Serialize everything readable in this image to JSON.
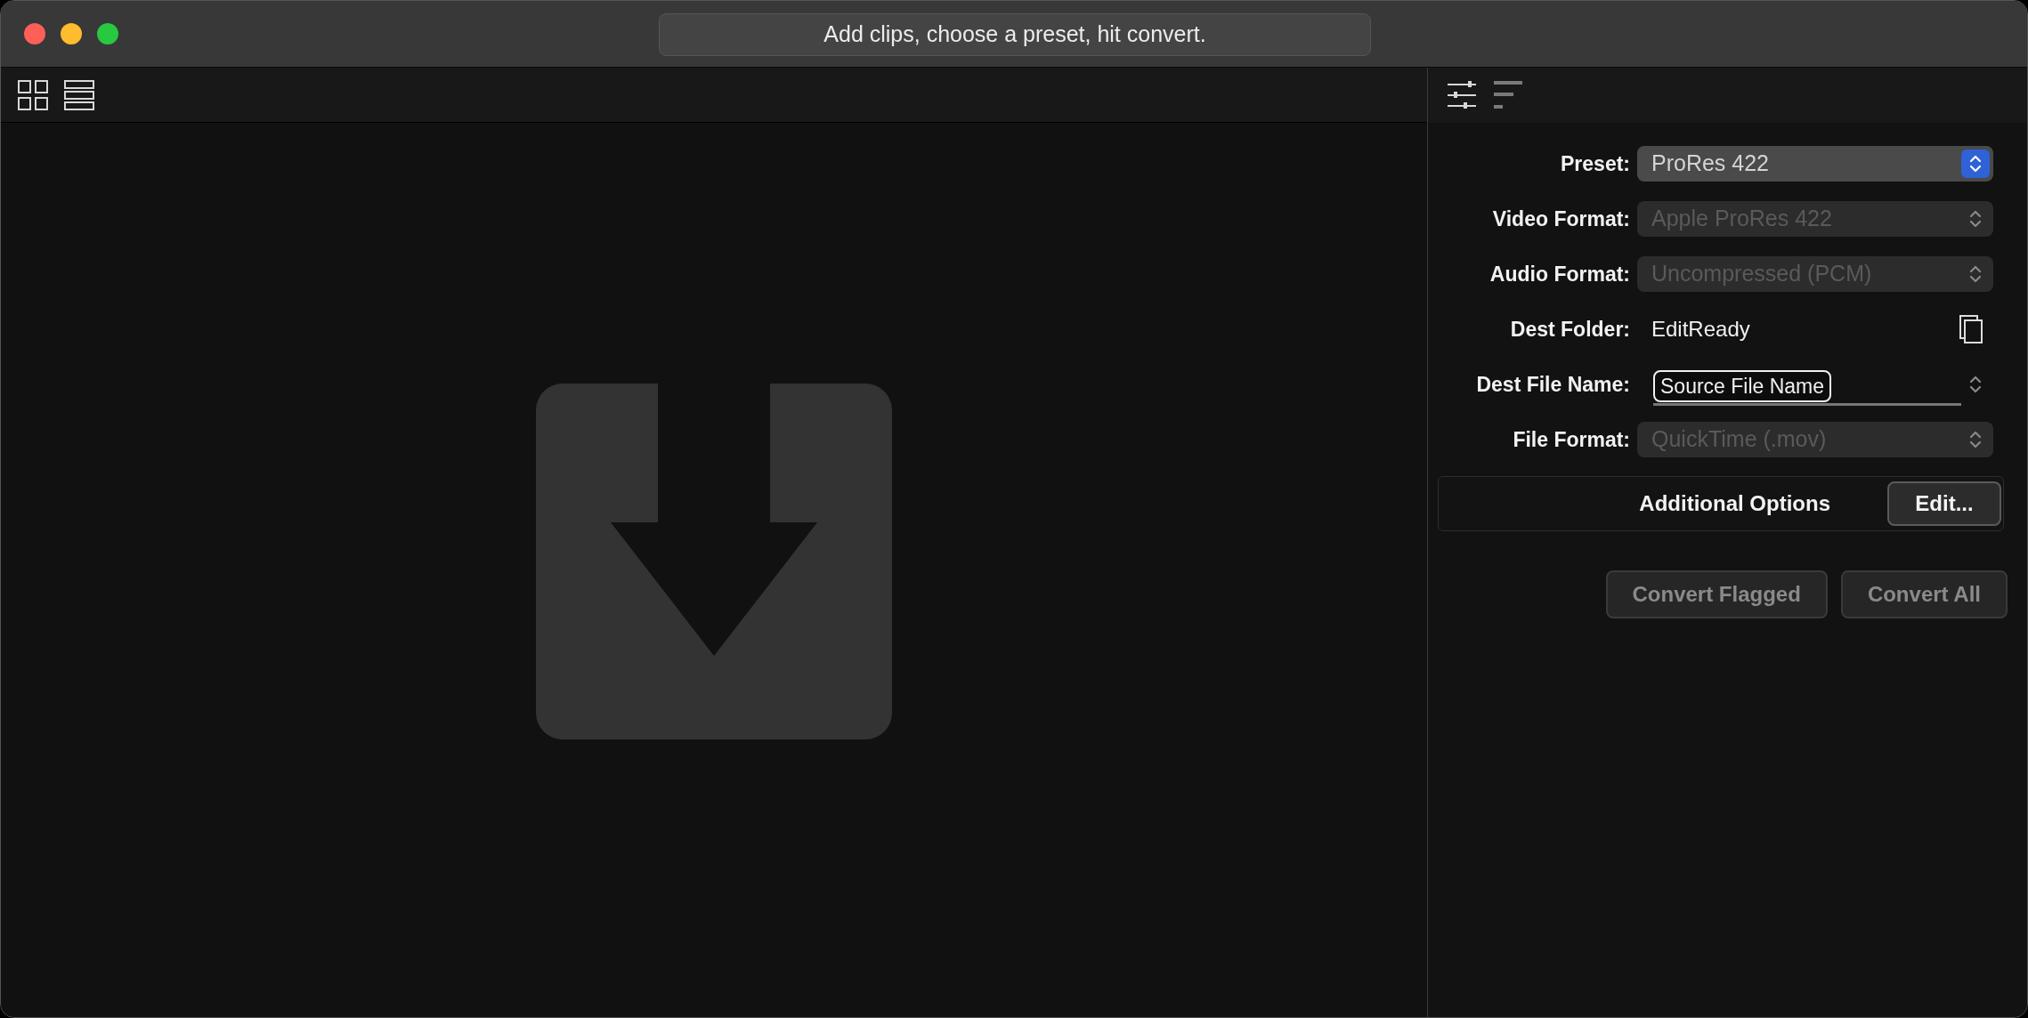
{
  "window": {
    "title": "Add clips, choose a preset, hit convert."
  },
  "view_toggles": [
    {
      "kind": "grid"
    },
    {
      "kind": "list"
    }
  ],
  "inspector_tabs": [
    {
      "kind": "settings",
      "selected": true
    },
    {
      "kind": "sort",
      "selected": false
    }
  ],
  "settings": [
    {
      "label": "Preset:",
      "kind": "popup",
      "value": "ProRes 422",
      "disabled": false
    },
    {
      "label": "Video Format:",
      "kind": "popup",
      "value": "Apple ProRes 422",
      "disabled": true
    },
    {
      "label": "Audio Format:",
      "kind": "popup",
      "value": "Uncompressed (PCM)",
      "disabled": true
    },
    {
      "label": "Dest Folder:",
      "kind": "folder",
      "value": "EditReady"
    },
    {
      "label": "Dest File Name:",
      "kind": "token",
      "value": "Source File Name"
    },
    {
      "label": "File Format:",
      "kind": "popup",
      "value": "QuickTime (.mov)",
      "disabled": true
    }
  ],
  "additional_options": {
    "label": "Additional Options",
    "button": "Edit..."
  },
  "actions": [
    {
      "label": "Convert Flagged",
      "disabled": true
    },
    {
      "label": "Convert All",
      "disabled": true
    }
  ]
}
